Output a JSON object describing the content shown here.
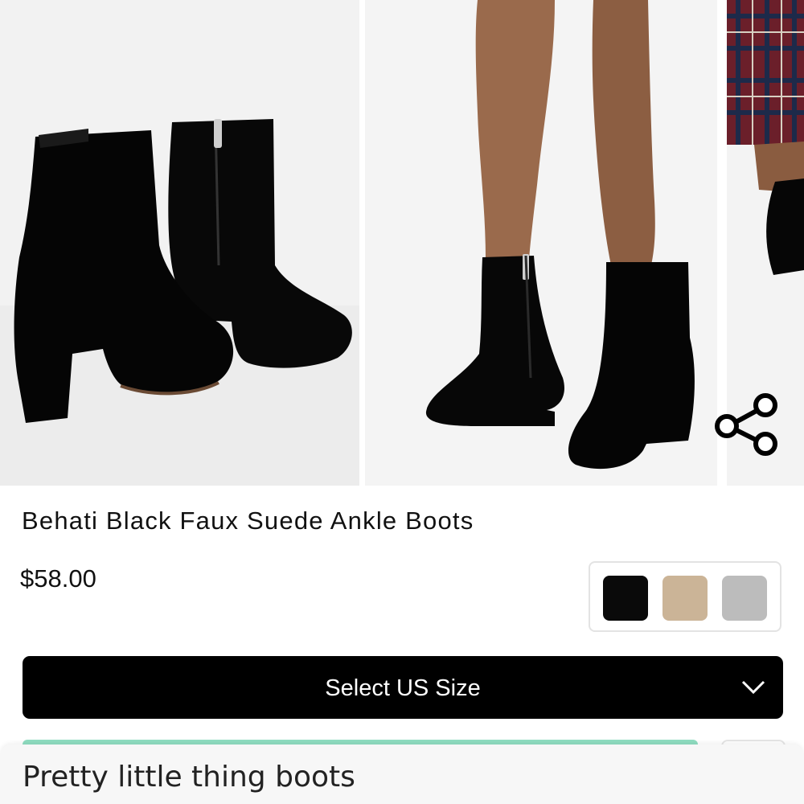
{
  "product": {
    "title": "Behati Black Faux Suede Ankle Boots",
    "price": "$58.00",
    "gallery": {
      "photos": [
        {
          "subject": "boots-pair-photo"
        },
        {
          "subject": "model-legs-photo"
        },
        {
          "subject": "plaid-model-photo"
        }
      ],
      "share_icon": "share-icon"
    },
    "swatches": [
      {
        "color": "#0a0a0a"
      },
      {
        "color": "#cbb497"
      },
      {
        "color": "#bcbcbc"
      }
    ],
    "size_select": {
      "label": "Select US Size",
      "icon": "chevron-down-icon"
    }
  },
  "caption": {
    "text": "Pretty little thing boots"
  },
  "colors": {
    "button_bg": "#000000",
    "accent": "#8fdcc0"
  }
}
